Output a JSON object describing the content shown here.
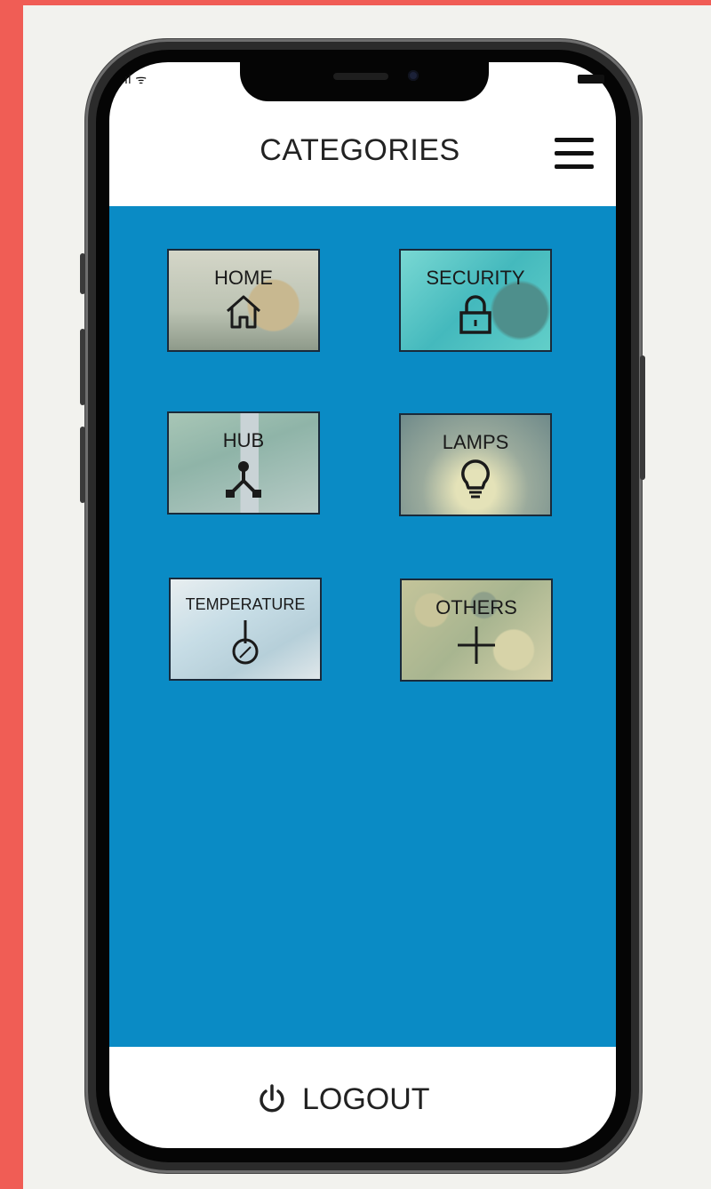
{
  "header": {
    "title": "CATEGORIES",
    "menu_icon": "hamburger-icon"
  },
  "status_bar": {
    "left": "ıl ᯤ"
  },
  "categories": [
    {
      "label": "HOME",
      "icon": "house-icon"
    },
    {
      "label": "SECURITY",
      "icon": "padlock-icon"
    },
    {
      "label": "HUB",
      "icon": "network-hub-icon"
    },
    {
      "label": "LAMPS",
      "icon": "lightbulb-icon"
    },
    {
      "label": "TEMPERATURE",
      "icon": "thermometer-icon"
    },
    {
      "label": "OTHERS",
      "icon": "plus-icon"
    }
  ],
  "footer": {
    "logout_label": "LOGOUT",
    "logout_icon": "power-icon"
  },
  "colors": {
    "panel": "#0a8bc5",
    "accent_frame": "#f05d55",
    "screen_bg": "#ffffff"
  }
}
